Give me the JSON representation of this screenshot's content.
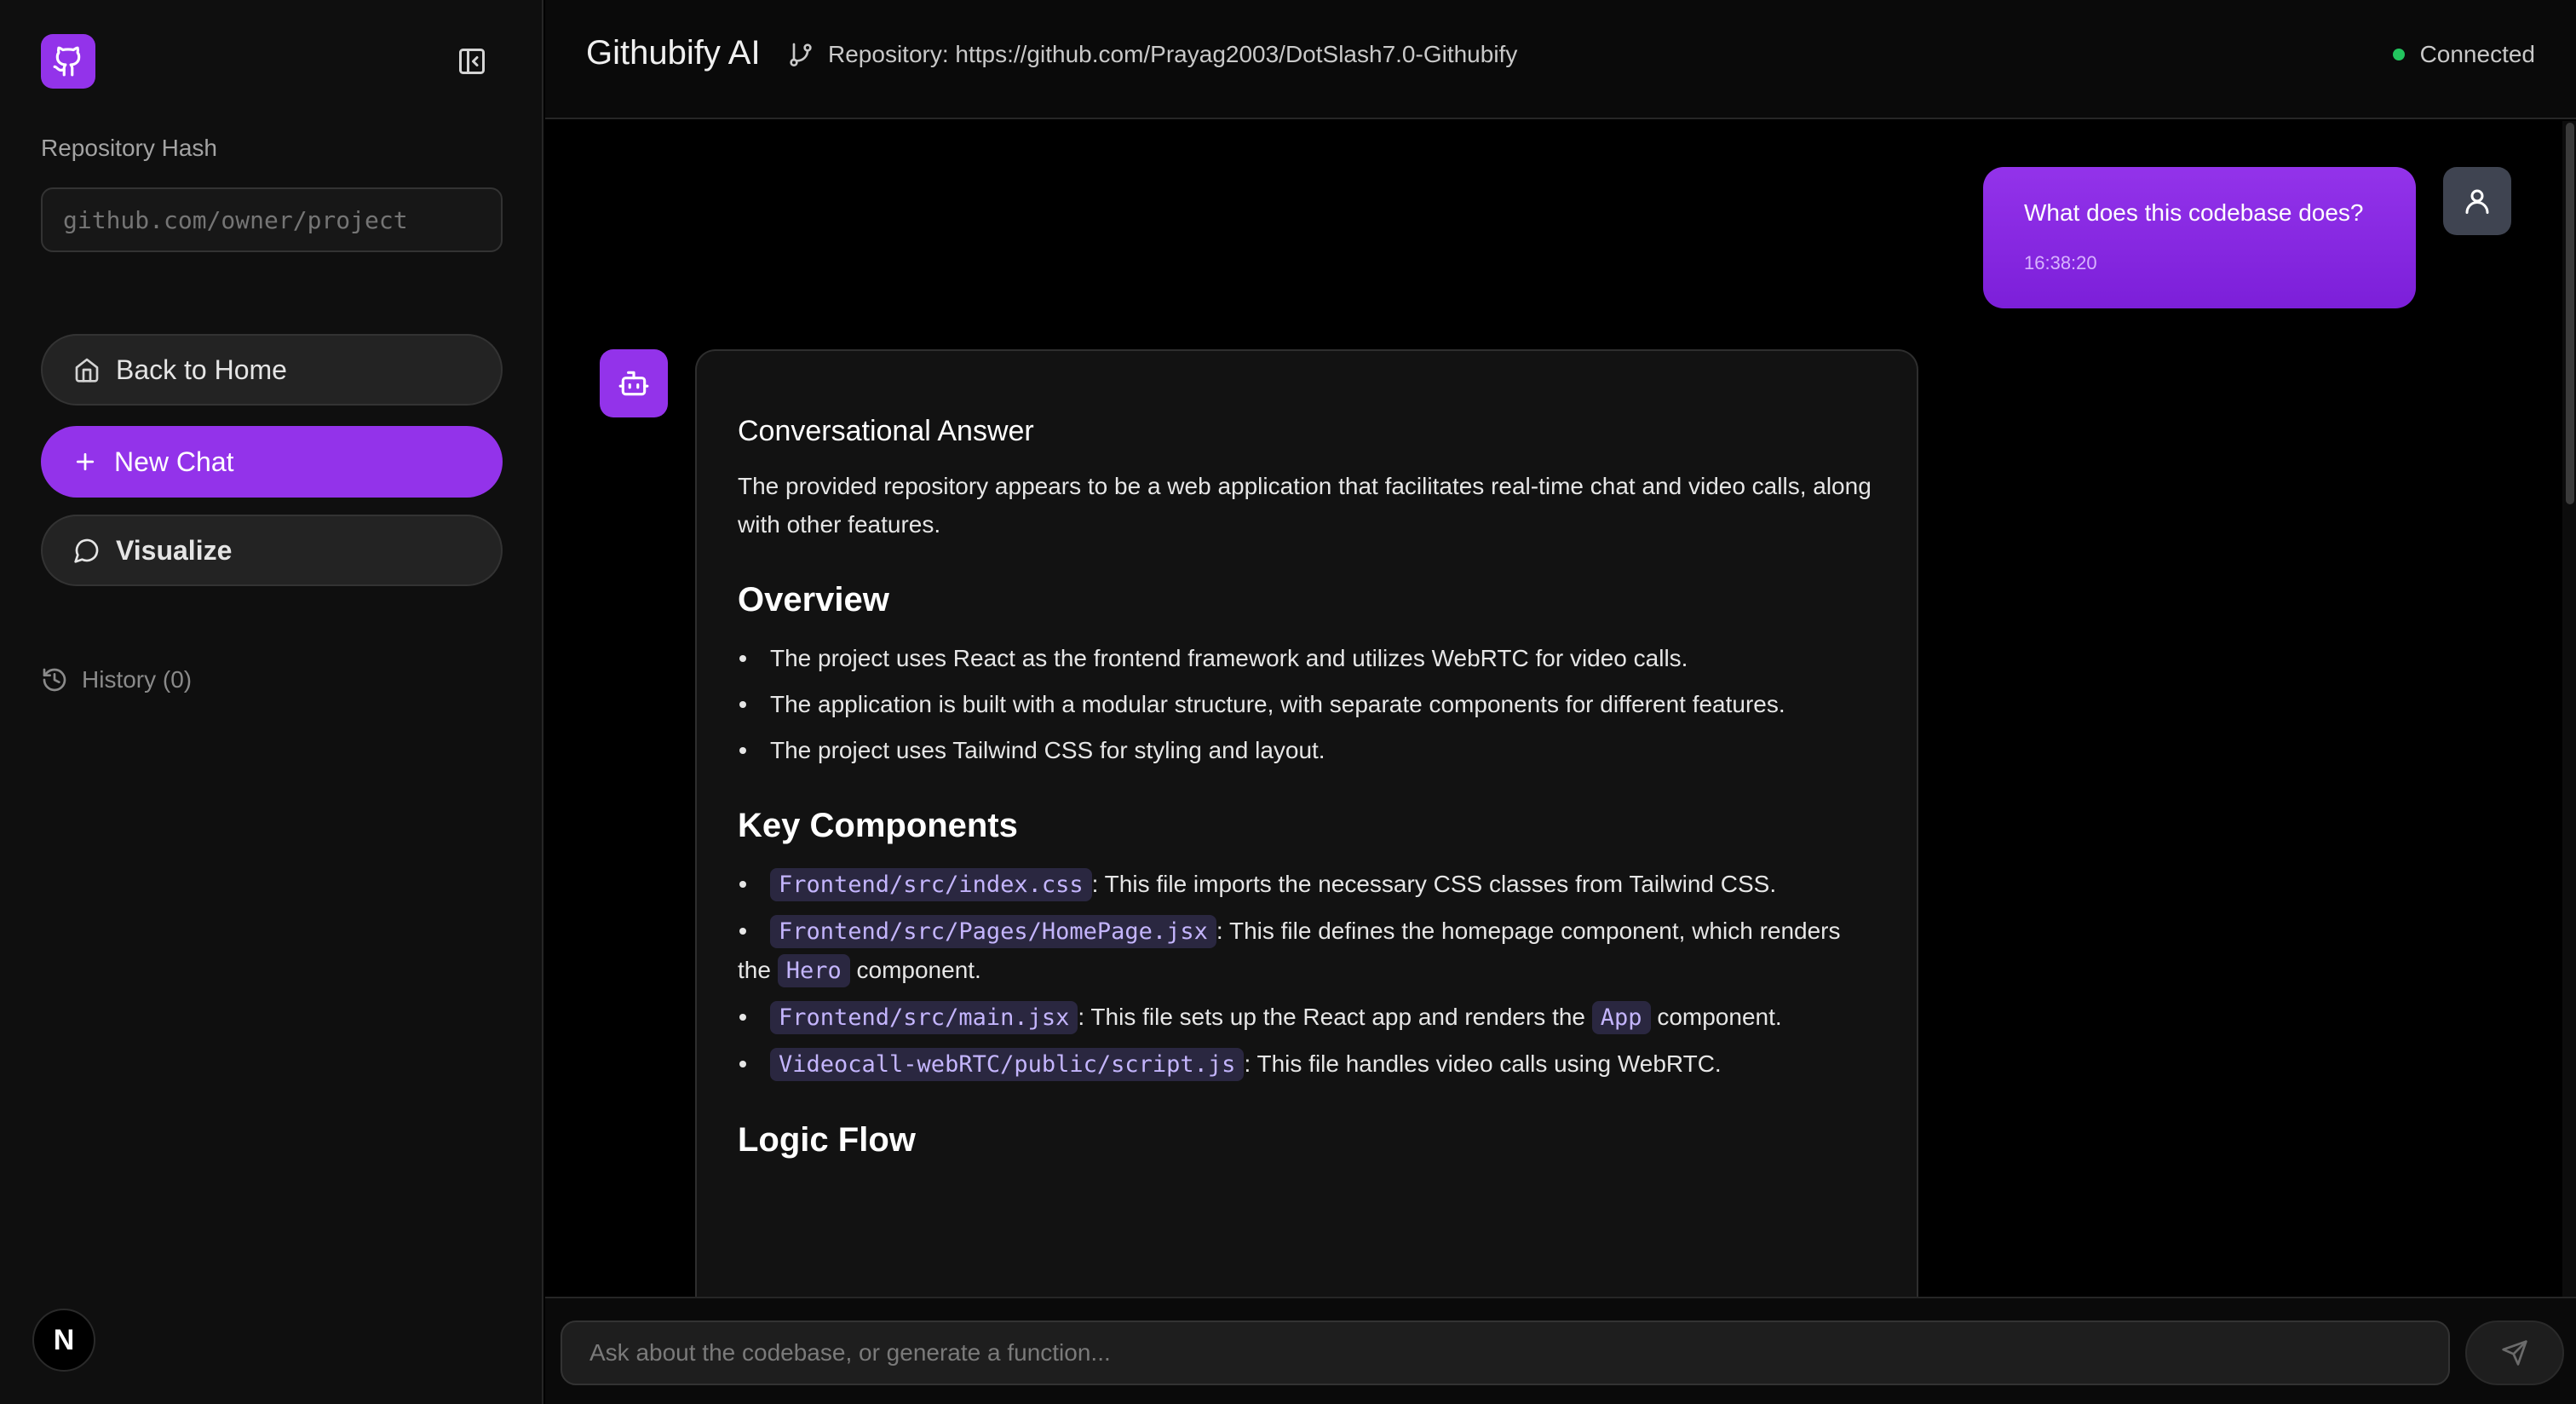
{
  "sidebar": {
    "repo_hash_label": "Repository Hash",
    "repo_hash_placeholder": "github.com/owner/project",
    "back_home_label": "Back to Home",
    "new_chat_label": "New Chat",
    "visualize_label": "Visualize",
    "history_label": "History (0)",
    "avatar_letter": "N"
  },
  "header": {
    "title": "Githubify AI",
    "repo_text": "Repository: https://github.com/Prayag2003/DotSlash7.0-Githubify",
    "status": "Connected"
  },
  "chat": {
    "user_message": {
      "text": "What does this codebase does?",
      "time": "16:38:20"
    },
    "bot_message": {
      "heading": "Conversational Answer",
      "intro": "The provided repository appears to be a web application that facilitates real-time chat and video calls, along with other features.",
      "overview_title": "Overview",
      "overview_items": [
        "The project uses React as the frontend framework and utilizes WebRTC for video calls.",
        "The application is built with a modular structure, with separate components for different features.",
        "The project uses Tailwind CSS for styling and layout."
      ],
      "key_components_title": "Key Components",
      "components": [
        {
          "code": "Frontend/src/index.css",
          "text": ": This file imports the necessary CSS classes from Tailwind CSS."
        },
        {
          "code": "Frontend/src/Pages/HomePage.jsx",
          "text": ": This file defines the homepage component, which renders the ",
          "code2": "Hero",
          "text2": " component."
        },
        {
          "code": "Frontend/src/main.jsx",
          "text": ": This file sets up the React app and renders the ",
          "code2": "App",
          "text2": " component."
        },
        {
          "code": "Videocall-webRTC/public/script.js",
          "text": ": This file handles video calls using WebRTC."
        }
      ],
      "logic_flow_title": "Logic Flow"
    }
  },
  "composer": {
    "placeholder": "Ask about the codebase, or generate a function..."
  },
  "colors": {
    "accent": "#9333ea",
    "status_ok": "#22c55e"
  },
  "icons": {
    "logo": "github-icon",
    "collapse": "sidebar-collapse-icon",
    "home": "home-icon",
    "new_chat": "plus-icon",
    "visualize": "chat-bubble-icon",
    "history": "history-icon",
    "branch": "git-branch-icon",
    "user": "user-icon",
    "bot": "bot-icon",
    "send": "send-icon"
  }
}
